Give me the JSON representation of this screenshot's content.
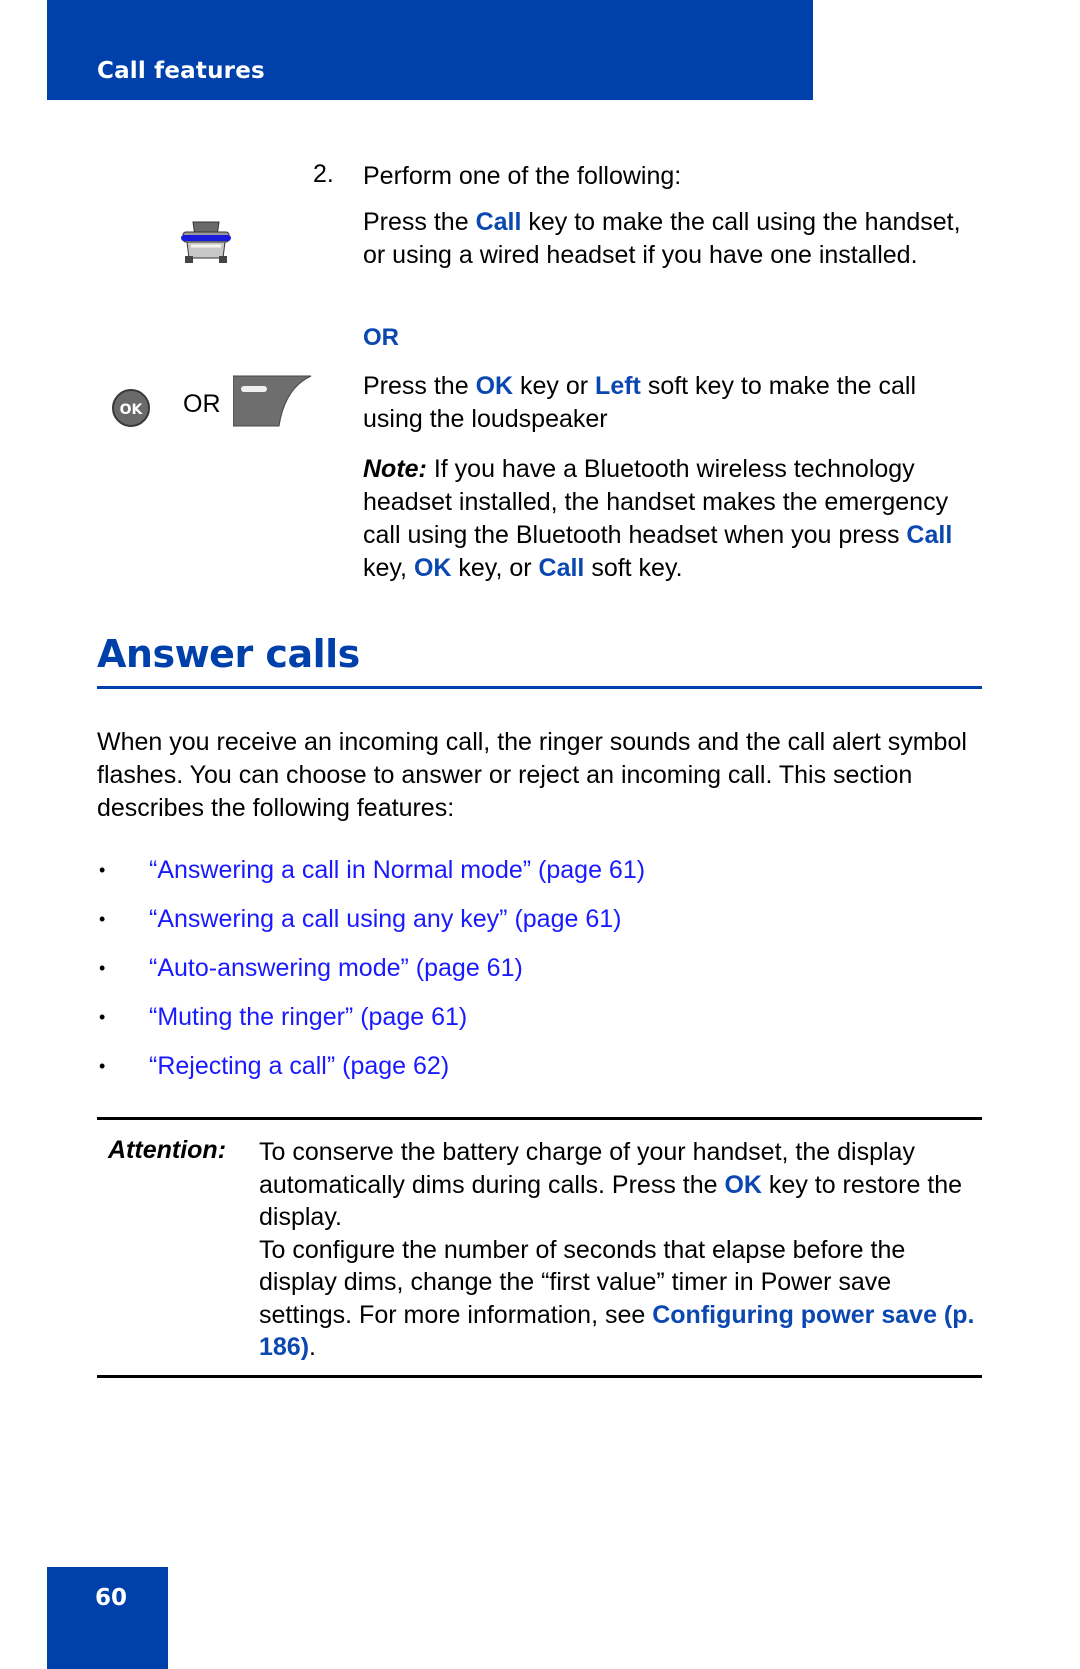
{
  "header": {
    "title": "Call features",
    "color": "#0040aa"
  },
  "step": {
    "number": "2.",
    "intro": "Perform one of the following:",
    "option1": {
      "pre": "Press the ",
      "key": "Call",
      "post_line": " key to make the call using the handset, or using a wired headset if you have one installed."
    },
    "or_label": "OR",
    "option2": {
      "pre": "Press the ",
      "key1": "OK",
      "mid": " key or ",
      "key2": "Left",
      "post": " soft key to make the call using the loudspeaker"
    },
    "note": {
      "label": "Note:",
      "text1": " If you have a Bluetooth wireless technology headset installed, the handset makes the emergency call using the Bluetooth headset when you press ",
      "key1": "Call",
      "text2": " key, ",
      "key2": "OK",
      "text3": " key, or ",
      "key3": "Call",
      "text4": " soft key."
    },
    "icons": {
      "phone": "call-key-phone-icon",
      "ok": "ok-key-icon",
      "ok_label": "OK",
      "or_text": "OR",
      "softkey": "left-soft-key-icon"
    }
  },
  "section": {
    "title": "Answer calls",
    "intro": "When you receive an incoming call, the ringer sounds and the call alert symbol flashes. You can choose to answer or reject an incoming call. This section describes the following features:",
    "bullets": [
      {
        "text": "“Answering a call in Normal mode” (page 61)"
      },
      {
        "text": "“Answering a call using any key” (page 61)"
      },
      {
        "text": "“Auto-answering mode” (page 61)"
      },
      {
        "text": "“Muting the ringer” (page 61)"
      },
      {
        "text": "“Rejecting a call” (page 62)"
      }
    ],
    "bullet_char": "•"
  },
  "attention": {
    "label": "Attention:",
    "p1_pre": "To conserve the battery charge of your handset, the display automatically dims during calls. Press the ",
    "p1_key": "OK",
    "p1_post": " key to restore the display.",
    "p2_pre": "To configure the number of seconds that elapse before the display dims, change the “first value” timer in Power save settings. For more information, see ",
    "p2_link": "Configuring power save (p. 186)",
    "p2_post": "."
  },
  "footer": {
    "page_number": "60"
  }
}
